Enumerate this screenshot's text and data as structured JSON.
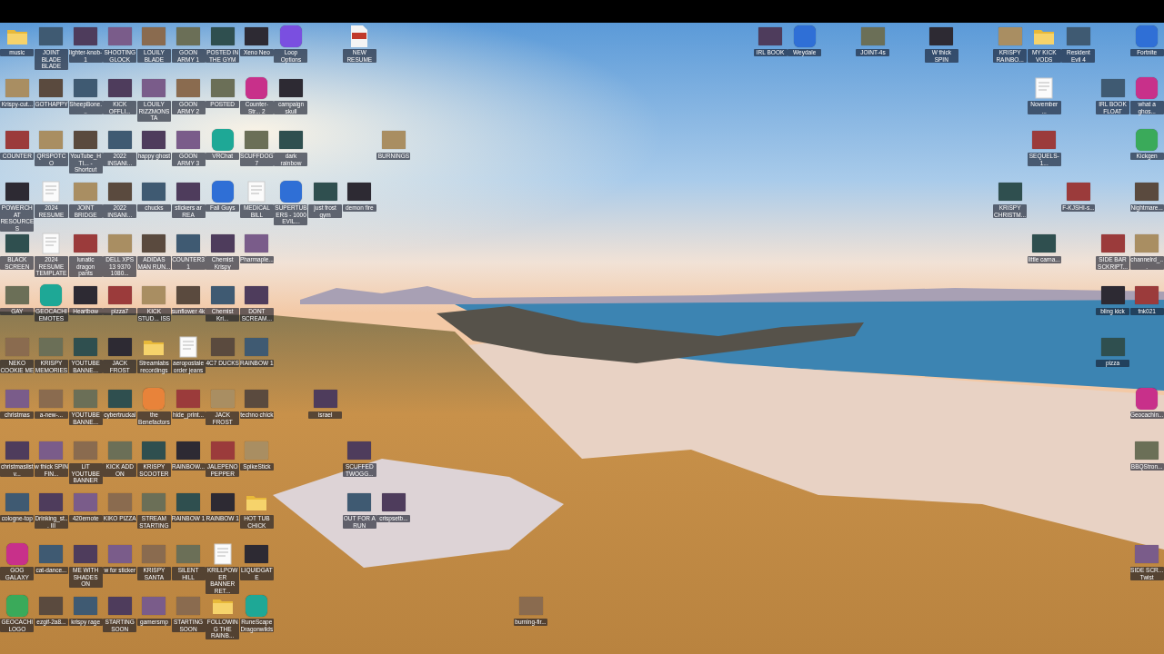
{
  "desktop": {
    "icon_rows": [
      [
        {
          "label": "music",
          "kind": "folder"
        },
        {
          "label": "JOINT BLADE BLADE",
          "kind": "image"
        },
        {
          "label": "lighter-knob-1",
          "kind": "image"
        },
        {
          "label": "SHOOTING GLOCK",
          "kind": "image"
        },
        {
          "label": "LOUILY BLADE",
          "kind": "image"
        },
        {
          "label": "GOON ARMY 1",
          "kind": "image"
        },
        {
          "label": "POSTED IN THE GYM",
          "kind": "image"
        },
        {
          "label": "Xeno Neo",
          "kind": "image"
        },
        {
          "label": "Loop Options",
          "kind": "app"
        },
        null,
        {
          "label": "NEW RESUME",
          "kind": "pdf"
        },
        null,
        null,
        null,
        null,
        null,
        null,
        null,
        null,
        null,
        null,
        null,
        {
          "label": "IRL BOOK",
          "kind": "image"
        },
        {
          "label": "Weydale",
          "kind": "app"
        },
        null,
        {
          "label": "JOINT-4s",
          "kind": "image"
        },
        null,
        {
          "label": "W thick SPIN",
          "kind": "image"
        },
        null,
        {
          "label": "KRISPY RAINBO...",
          "kind": "image"
        },
        {
          "label": "MY KICK VODS",
          "kind": "folder"
        },
        {
          "label": "Resident Evil 4",
          "kind": "image"
        },
        null,
        {
          "label": "Fortnite",
          "kind": "app"
        }
      ],
      [
        {
          "label": "Krispy-cut...",
          "kind": "image"
        },
        {
          "label": "GOTHAPPY",
          "kind": "image"
        },
        {
          "label": "SheepBone...",
          "kind": "image"
        },
        {
          "label": "KICK OFFLI...",
          "kind": "image"
        },
        {
          "label": "LOUILY RIZZMONSTA",
          "kind": "image"
        },
        {
          "label": "GOON ARMY 2",
          "kind": "image"
        },
        {
          "label": "POSTED",
          "kind": "image"
        },
        {
          "label": "Counter-Str... 2",
          "kind": "app"
        },
        {
          "label": "campaign skull",
          "kind": "image"
        },
        null,
        null,
        null,
        null,
        null,
        null,
        null,
        null,
        null,
        null,
        null,
        null,
        null,
        null,
        null,
        null,
        null,
        null,
        null,
        null,
        null,
        {
          "label": "November ...",
          "kind": "document"
        },
        null,
        {
          "label": "IRL BOOK FLOAT",
          "kind": "image"
        },
        {
          "label": "what a ghos...",
          "kind": "app"
        }
      ],
      [
        {
          "label": "COUNTER",
          "kind": "image"
        },
        {
          "label": "QRSPOTCO",
          "kind": "image"
        },
        {
          "label": "YouTube_HTI... - Shortcut",
          "kind": "image"
        },
        {
          "label": "2022 INSANI...",
          "kind": "image"
        },
        {
          "label": "happy ghost",
          "kind": "image"
        },
        {
          "label": "GOON ARMY 3",
          "kind": "image"
        },
        {
          "label": "VRChat",
          "kind": "app"
        },
        {
          "label": "SCUFFDOG 7",
          "kind": "image"
        },
        {
          "label": "dark rainbow",
          "kind": "image"
        },
        null,
        null,
        {
          "label": "BURNINGS",
          "kind": "image"
        },
        null,
        null,
        null,
        null,
        null,
        null,
        null,
        null,
        null,
        null,
        null,
        null,
        null,
        null,
        null,
        null,
        null,
        null,
        {
          "label": "SEQUELS-1...",
          "kind": "image"
        },
        null,
        null,
        {
          "label": "Kickgen",
          "kind": "app"
        }
      ],
      [
        {
          "label": "POWERCHAT RESOURCES",
          "kind": "image"
        },
        {
          "label": "2024 RESUME",
          "kind": "document"
        },
        {
          "label": "JOINT BRIDGE",
          "kind": "image"
        },
        {
          "label": "2022 INSANI...",
          "kind": "image"
        },
        {
          "label": "chucks",
          "kind": "image"
        },
        {
          "label": "stickers ar REA",
          "kind": "image"
        },
        {
          "label": "Fall Guys",
          "kind": "app"
        },
        {
          "label": "MEDICAL BILL",
          "kind": "document"
        },
        {
          "label": "SUPERTUBERS - 1000 EVIL...",
          "kind": "app"
        },
        {
          "label": "just frost gym",
          "kind": "image"
        },
        {
          "label": "demon fire",
          "kind": "image"
        },
        null,
        null,
        null,
        null,
        null,
        null,
        null,
        null,
        null,
        null,
        null,
        null,
        null,
        null,
        null,
        null,
        null,
        null,
        {
          "label": "KRISPY CHRISTM...",
          "kind": "image"
        },
        null,
        {
          "label": "F-KJSHI-s...",
          "kind": "image"
        },
        null,
        {
          "label": "Nightmare...",
          "kind": "image"
        }
      ],
      [
        {
          "label": "BLACK SCREEN",
          "kind": "image"
        },
        {
          "label": "2024 RESUME TEMPLATE",
          "kind": "document"
        },
        {
          "label": "lunatic dragon pants",
          "kind": "image"
        },
        {
          "label": "DELL XPS 13 9370 1080...",
          "kind": "image"
        },
        {
          "label": "ADIDAS MAN RUN...",
          "kind": "image"
        },
        {
          "label": "COUNTER31",
          "kind": "image"
        },
        {
          "label": "Chemist Krispy",
          "kind": "image"
        },
        {
          "label": "Pharmaple...",
          "kind": "image"
        },
        null,
        null,
        null,
        null,
        null,
        null,
        null,
        null,
        null,
        null,
        null,
        null,
        null,
        null,
        null,
        null,
        null,
        null,
        null,
        null,
        null,
        null,
        {
          "label": "little carna...",
          "kind": "image"
        },
        null,
        {
          "label": "SIDE BAR SCKRIPT...",
          "kind": "image"
        },
        {
          "label": "channelrd_...",
          "kind": "image"
        }
      ],
      [
        {
          "label": "GAY",
          "kind": "image"
        },
        {
          "label": "GEOCACHI EMOTES",
          "kind": "app"
        },
        {
          "label": "Heartbow",
          "kind": "image"
        },
        {
          "label": "pizza7",
          "kind": "image"
        },
        {
          "label": "KICK STUD... ISS",
          "kind": "image"
        },
        {
          "label": "sunflower 4k",
          "kind": "image"
        },
        {
          "label": "Chemist Kri...",
          "kind": "image"
        },
        {
          "label": "DONT SCREAM...",
          "kind": "image"
        },
        null,
        null,
        null,
        null,
        null,
        null,
        null,
        null,
        null,
        null,
        null,
        null,
        null,
        null,
        null,
        null,
        null,
        null,
        null,
        null,
        null,
        null,
        null,
        null,
        {
          "label": "bling kick",
          "kind": "image"
        },
        {
          "label": "fnk021",
          "kind": "image"
        }
      ],
      [
        {
          "label": "NEKO COOKIE ME",
          "kind": "image"
        },
        {
          "label": "KRISPY MEMORIES",
          "kind": "image"
        },
        {
          "label": "YOUTUBE BANNE...",
          "kind": "image"
        },
        {
          "label": "JACK FROST",
          "kind": "image"
        },
        {
          "label": "Streamlabs recordings",
          "kind": "folder"
        },
        {
          "label": "aeropostale order jeans",
          "kind": "document"
        },
        {
          "label": "4C7 DUCKS",
          "kind": "image"
        },
        {
          "label": "RAINBOW 1",
          "kind": "image"
        },
        null,
        null,
        null,
        null,
        null,
        null,
        null,
        null,
        null,
        null,
        null,
        null,
        null,
        null,
        null,
        null,
        null,
        null,
        null,
        null,
        null,
        null,
        null,
        null,
        {
          "label": "pizza",
          "kind": "image"
        }
      ],
      [
        {
          "label": "christmas",
          "kind": "image"
        },
        {
          "label": "a-new-...",
          "kind": "image"
        },
        {
          "label": "YOUTUBE BANNE...",
          "kind": "image"
        },
        {
          "label": "cybertruckal",
          "kind": "image"
        },
        {
          "label": "the Benefactors",
          "kind": "app"
        },
        {
          "label": "hide_print...",
          "kind": "image"
        },
        {
          "label": "JACK FROST",
          "kind": "image"
        },
        {
          "label": "techno chick",
          "kind": "image"
        },
        null,
        {
          "label": "israel",
          "kind": "image"
        },
        null,
        null,
        null,
        null,
        null,
        null,
        null,
        null,
        null,
        null,
        null,
        null,
        null,
        null,
        null,
        null,
        null,
        null,
        null,
        null,
        null,
        null,
        null,
        {
          "label": "Geocachin...",
          "kind": "app"
        }
      ],
      [
        {
          "label": "christmaslistv...",
          "kind": "image"
        },
        {
          "label": "w thick SPIN FIN...",
          "kind": "image"
        },
        {
          "label": "LIT YOUTUBE BANNER",
          "kind": "image"
        },
        {
          "label": "KICK ADD ON",
          "kind": "image"
        },
        {
          "label": "KRISPY SCOOTER",
          "kind": "image"
        },
        {
          "label": "RAINBOW...",
          "kind": "image"
        },
        {
          "label": "JALEPENO PEPPER",
          "kind": "image"
        },
        {
          "label": "SpikeStick",
          "kind": "image"
        },
        null,
        null,
        {
          "label": "SCUFFED TWOGG...",
          "kind": "image"
        },
        null,
        null,
        null,
        null,
        null,
        null,
        null,
        null,
        null,
        null,
        null,
        null,
        null,
        null,
        null,
        null,
        null,
        null,
        null,
        null,
        null,
        null,
        {
          "label": "BBQStron...",
          "kind": "image"
        }
      ],
      [
        {
          "label": "cologne-top",
          "kind": "image"
        },
        {
          "label": "Drinking_st... III",
          "kind": "image"
        },
        {
          "label": "420emote",
          "kind": "image"
        },
        {
          "label": "KIKO PIZZA",
          "kind": "image"
        },
        {
          "label": "STREAM STARTING",
          "kind": "image"
        },
        {
          "label": "RAINBOW 1",
          "kind": "image"
        },
        {
          "label": "RAINBOW 1",
          "kind": "image"
        },
        {
          "label": "HOT TUB CHICK",
          "kind": "folder"
        },
        null,
        null,
        {
          "label": "OUT FOR A RUN",
          "kind": "image"
        },
        {
          "label": "crispsetb...",
          "kind": "image"
        }
      ],
      [
        {
          "label": "GOG GALAXY",
          "kind": "app"
        },
        {
          "label": "cat-dance...",
          "kind": "image"
        },
        {
          "label": "ME WITH SHADES ON",
          "kind": "image"
        },
        {
          "label": "w for sticker",
          "kind": "image"
        },
        {
          "label": "KRISPY SANTA",
          "kind": "image"
        },
        {
          "label": "SILENT HILL",
          "kind": "image"
        },
        {
          "label": "KRILLPOWER BANNER RET...",
          "kind": "document"
        },
        {
          "label": "LIQUIDGATE",
          "kind": "image"
        },
        null,
        null,
        null,
        null,
        null,
        null,
        null,
        null,
        null,
        null,
        null,
        null,
        null,
        null,
        null,
        null,
        null,
        null,
        null,
        null,
        null,
        null,
        null,
        null,
        null,
        {
          "label": "SIDE SCR... Twist",
          "kind": "image"
        }
      ],
      [
        {
          "label": "GEOCACHI LOGO",
          "kind": "app"
        },
        {
          "label": "ezgif-2a8...",
          "kind": "image"
        },
        {
          "label": "krispy rage",
          "kind": "image"
        },
        {
          "label": "STARTING SOON",
          "kind": "image"
        },
        {
          "label": "gamersmp",
          "kind": "image"
        },
        {
          "label": "STARTING SOON",
          "kind": "image"
        },
        {
          "label": "FOLLOWING THE RAINB...",
          "kind": "folder"
        },
        {
          "label": "RuneScape Dragonwilds",
          "kind": "app"
        },
        null,
        null,
        null,
        null,
        null,
        null,
        null,
        {
          "label": "burning-fir...",
          "kind": "image"
        }
      ]
    ]
  }
}
